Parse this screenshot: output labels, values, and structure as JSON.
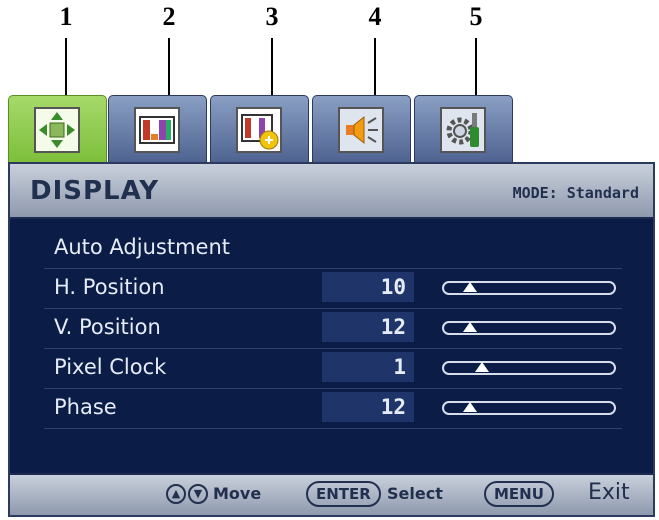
{
  "callouts": [
    "1",
    "2",
    "3",
    "4",
    "5"
  ],
  "tabs": [
    {
      "icon": "position-arrows-icon",
      "active": true
    },
    {
      "icon": "color-bars-icon",
      "active": false
    },
    {
      "icon": "color-bars-add-icon",
      "active": false
    },
    {
      "icon": "speaker-icon",
      "active": false
    },
    {
      "icon": "gear-screwdriver-icon",
      "active": false
    }
  ],
  "header": {
    "title": "DISPLAY",
    "mode": "MODE: Standard"
  },
  "rows": [
    {
      "label": "Auto Adjustment"
    },
    {
      "label": "H. Position",
      "value": "10",
      "level": 0.12
    },
    {
      "label": "V. Position",
      "value": "12",
      "level": 0.12
    },
    {
      "label": "Pixel Clock",
      "value": "1",
      "level": 0.2
    },
    {
      "label": "Phase",
      "value": "12",
      "level": 0.12
    }
  ],
  "footer": {
    "up_icon": "up-arrow-icon",
    "down_icon": "down-arrow-icon",
    "move_label": "Move",
    "enter_label": "ENTER",
    "select_label": "Select",
    "menu_label": "MENU",
    "exit_label": "Exit"
  },
  "colors": {
    "panel_bg": "#0b1d47",
    "active_tab": "#8cca4a",
    "inactive_tab": "#5f74a0"
  }
}
